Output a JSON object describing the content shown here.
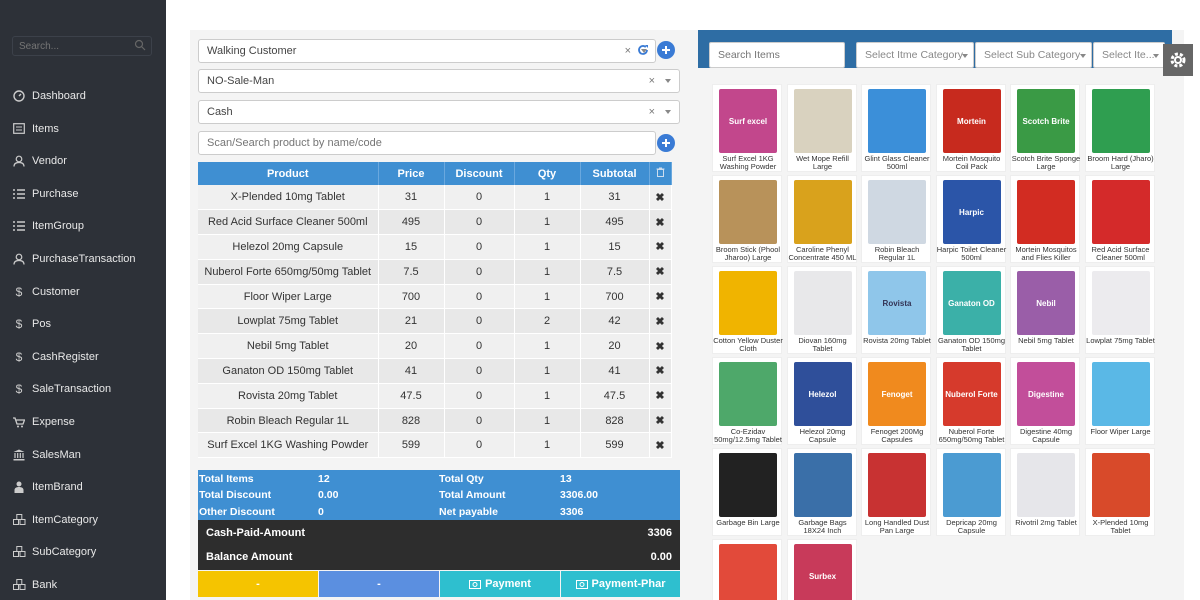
{
  "sidebar": {
    "search_placeholder": "Search...",
    "items": [
      {
        "label": "Dashboard",
        "icon": "dashboard-icon"
      },
      {
        "label": "Items",
        "icon": "items-icon"
      },
      {
        "label": "Vendor",
        "icon": "user-icon"
      },
      {
        "label": "Purchase",
        "icon": "list-icon"
      },
      {
        "label": "ItemGroup",
        "icon": "list-icon"
      },
      {
        "label": "PurchaseTransaction",
        "icon": "user-icon"
      },
      {
        "label": "Customer",
        "icon": "dollar-icon"
      },
      {
        "label": "Pos",
        "icon": "dollar-icon"
      },
      {
        "label": "CashRegister",
        "icon": "dollar-icon"
      },
      {
        "label": "SaleTransaction",
        "icon": "dollar-icon"
      },
      {
        "label": "Expense",
        "icon": "cart-icon"
      },
      {
        "label": "SalesMan",
        "icon": "bank-icon"
      },
      {
        "label": "ItemBrand",
        "icon": "person-icon"
      },
      {
        "label": "ItemCategory",
        "icon": "cubes-icon"
      },
      {
        "label": "SubCategory",
        "icon": "cubes-icon"
      },
      {
        "label": "Bank",
        "icon": "cubes-icon"
      }
    ]
  },
  "pos": {
    "customer_value": "Walking Customer",
    "salesman_value": "NO-Sale-Man",
    "payment_value": "Cash",
    "clear_symbol": "×",
    "scan_placeholder": "Scan/Search product by name/code",
    "table_headers": [
      "Product",
      "Price",
      "Discount",
      "Qty",
      "Subtotal"
    ],
    "rows": [
      {
        "product": "X-Plended 10mg Tablet",
        "price": "31",
        "discount": "0",
        "qty": "1",
        "subtotal": "31"
      },
      {
        "product": "Red Acid Surface Cleaner 500ml",
        "price": "495",
        "discount": "0",
        "qty": "1",
        "subtotal": "495"
      },
      {
        "product": "Helezol 20mg Capsule",
        "price": "15",
        "discount": "0",
        "qty": "1",
        "subtotal": "15"
      },
      {
        "product": "Nuberol Forte 650mg/50mg Tablet",
        "price": "7.5",
        "discount": "0",
        "qty": "1",
        "subtotal": "7.5"
      },
      {
        "product": "Floor Wiper Large",
        "price": "700",
        "discount": "0",
        "qty": "1",
        "subtotal": "700"
      },
      {
        "product": "Lowplat 75mg Tablet",
        "price": "21",
        "discount": "0",
        "qty": "2",
        "subtotal": "42"
      },
      {
        "product": "Nebil 5mg Tablet",
        "price": "20",
        "discount": "0",
        "qty": "1",
        "subtotal": "20"
      },
      {
        "product": "Ganaton OD 150mg Tablet",
        "price": "41",
        "discount": "0",
        "qty": "1",
        "subtotal": "41"
      },
      {
        "product": "Rovista 20mg Tablet",
        "price": "47.5",
        "discount": "0",
        "qty": "1",
        "subtotal": "47.5"
      },
      {
        "product": "Robin Bleach Regular 1L",
        "price": "828",
        "discount": "0",
        "qty": "1",
        "subtotal": "828"
      },
      {
        "product": "Surf Excel 1KG Washing Powder",
        "price": "599",
        "discount": "0",
        "qty": "1",
        "subtotal": "599"
      }
    ],
    "remove_symbol": "✖",
    "totals": {
      "total_items_label": "Total Items",
      "total_items": "12",
      "total_qty_label": "Total Qty",
      "total_qty": "13",
      "total_discount_label": "Total Discount",
      "total_discount": "0.00",
      "total_amount_label": "Total Amount",
      "total_amount": "3306.00",
      "other_discount_label": "Other Discount",
      "other_discount": "0",
      "net_payable_label": "Net payable",
      "net_payable": "3306"
    },
    "cash_paid_label": "Cash-Paid-Amount",
    "cash_paid": "3306",
    "balance_label": "Balance Amount",
    "balance": "0.00",
    "buttons": {
      "btn1": "-",
      "btn2": "-",
      "payment": "Payment",
      "payment_phar": "Payment-Phar"
    },
    "colors": {
      "header_blue": "#3f8fd2",
      "yellow": "#f5c400",
      "light_blue": "#5b8fe0",
      "cyan": "#2ebfcf"
    }
  },
  "items_panel": {
    "search_placeholder": "Search Items",
    "category_placeholder": "Select Itme Category",
    "subcategory_placeholder": "Select Sub Category",
    "item_placeholder": "Select Ite...",
    "products": [
      {
        "name": "Surf Excel 1KG Washing Powder",
        "color": "#c2478c"
      },
      {
        "name": "Wet Mope Refill Large",
        "color": "#d9d2bf"
      },
      {
        "name": "Glint Glass Cleaner 500ml",
        "color": "#3b8fd9"
      },
      {
        "name": "Mortein Mosquito Coil Pack",
        "color": "#c72a1e"
      },
      {
        "name": "Scotch Brite Sponge Large",
        "color": "#3a9a45"
      },
      {
        "name": "Broom Hard (Jharo) Large",
        "color": "#2f9e50"
      },
      {
        "name": "Broom Stick (Phool Jharoo) Large",
        "color": "#b8925a"
      },
      {
        "name": "Caroline Phenyl Concentrate 450 ML",
        "color": "#d9a21c"
      },
      {
        "name": "Robin Bleach Regular 1L",
        "color": "#cfd8e2"
      },
      {
        "name": "Harpic Toilet Cleaner 500ml",
        "color": "#2b55a8"
      },
      {
        "name": "Mortein Mosquitos and Flies Killer",
        "color": "#d22c22"
      },
      {
        "name": "Red Acid Surface Cleaner 500ml",
        "color": "#d42a2a"
      },
      {
        "name": "Cotton Yellow Duster Cloth",
        "color": "#f0b400"
      },
      {
        "name": "Diovan 160mg Tablet",
        "color": "#e8e8ea"
      },
      {
        "name": "Rovista 20mg Tablet",
        "color": "#8fc6ea"
      },
      {
        "name": "Ganaton OD 150mg Tablet",
        "color": "#3bb0a8"
      },
      {
        "name": "Nebil 5mg Tablet",
        "color": "#9a5ea8"
      },
      {
        "name": "Lowplat 75mg Tablet",
        "color": "#ecebee"
      },
      {
        "name": "Co-Ezidav 50mg/12.5mg Tablet",
        "color": "#4ea86a"
      },
      {
        "name": "Helezol 20mg Capsule",
        "color": "#2f4f9a"
      },
      {
        "name": "Fenoget 200Mg Capsules",
        "color": "#f08a1e"
      },
      {
        "name": "Nuberol Forte 650mg/50mg Tablet",
        "color": "#d63a2c"
      },
      {
        "name": "Digestine 40mg Capsule",
        "color": "#c24e9a"
      },
      {
        "name": "Floor Wiper Large",
        "color": "#5ab8e6"
      },
      {
        "name": "Garbage Bin Large",
        "color": "#222222"
      },
      {
        "name": "Garbage Bags 18X24 Inch",
        "color": "#3a6fa8"
      },
      {
        "name": "Long Handled Dust Pan Large",
        "color": "#c83232"
      },
      {
        "name": "Depricap 20mg Capsule",
        "color": "#4b9bd2"
      },
      {
        "name": "Rivotril 2mg Tablet",
        "color": "#e6e6ea"
      },
      {
        "name": "X-Plended 10mg Tablet",
        "color": "#d84a2a"
      },
      {
        "name": "",
        "color": "#e24a3a"
      },
      {
        "name": "",
        "color": "#c83a5a"
      }
    ],
    "product_image_text": [
      "Surf excel",
      "",
      "",
      "Mortein",
      "Scotch Brite",
      "",
      "",
      "",
      "",
      "Harpic",
      "",
      "",
      "",
      "",
      "Rovista",
      "Ganaton OD",
      "Nebil",
      "",
      "",
      "Helezol",
      "Fenoget",
      "Nuberol Forte",
      "Digestine",
      "",
      "",
      "",
      "",
      "",
      "",
      "",
      "",
      "Surbex"
    ]
  }
}
